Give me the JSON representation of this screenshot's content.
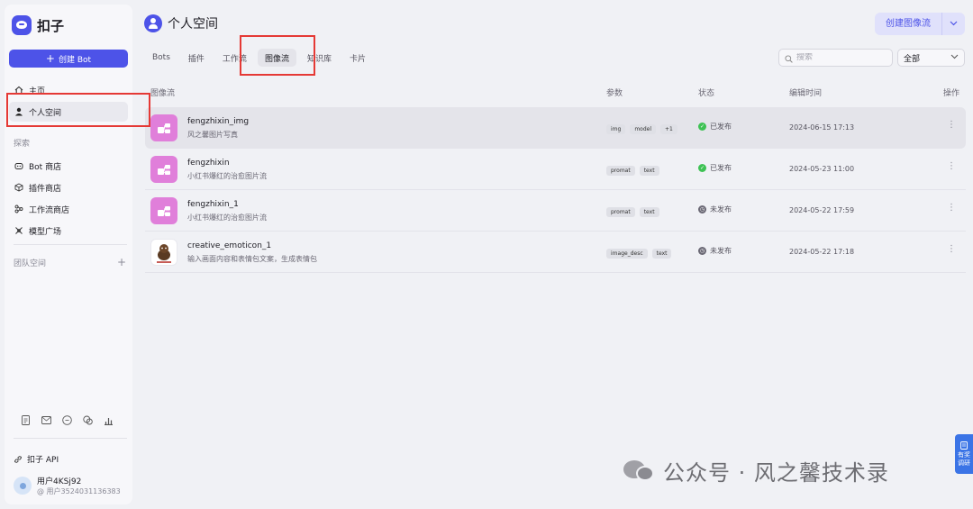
{
  "app": {
    "name": "扣子"
  },
  "sidebar": {
    "create_bot_label": "创建 Bot",
    "nav": [
      {
        "label": "主页",
        "icon": "home-icon"
      },
      {
        "label": "个人空间",
        "icon": "user-icon"
      }
    ],
    "explore_label": "探索",
    "explore": [
      {
        "label": "Bot 商店",
        "icon": "bot-icon"
      },
      {
        "label": "插件商店",
        "icon": "cube-icon"
      },
      {
        "label": "工作流商店",
        "icon": "workflow-icon"
      },
      {
        "label": "模型广场",
        "icon": "model-icon"
      }
    ],
    "team_label": "团队空间",
    "api_label": "扣子 API",
    "user": {
      "name": "用户4KSj92",
      "id": "@ 用户3524031136383"
    }
  },
  "header": {
    "title": "个人空间",
    "create_button": "创建图像流"
  },
  "tabs": [
    {
      "label": "Bots",
      "active": false
    },
    {
      "label": "插件",
      "active": false
    },
    {
      "label": "工作流",
      "active": false
    },
    {
      "label": "图像流",
      "active": true
    },
    {
      "label": "知识库",
      "active": false
    },
    {
      "label": "卡片",
      "active": false
    }
  ],
  "search": {
    "placeholder": "搜索",
    "value": ""
  },
  "filter": {
    "selected": "全部"
  },
  "table": {
    "columns": {
      "name": "图像流",
      "params": "参数",
      "status": "状态",
      "edit_time": "编辑时间",
      "actions": "操作"
    },
    "rows": [
      {
        "name": "fengzhixin_img",
        "desc": "风之馨图片写真",
        "tags": [
          "img",
          "model",
          "+1"
        ],
        "status": "已发布",
        "status_type": "published",
        "time": "2024-06-15 17:13",
        "icon": "image-flow-icon"
      },
      {
        "name": "fengzhixin",
        "desc": "小红书爆红的治愈图片流",
        "tags": [
          "promat",
          "text"
        ],
        "status": "已发布",
        "status_type": "published",
        "time": "2024-05-23 11:00",
        "icon": "image-flow-icon"
      },
      {
        "name": "fengzhixin_1",
        "desc": "小红书爆红的治愈图片流",
        "tags": [
          "promat",
          "text"
        ],
        "status": "未发布",
        "status_type": "unpublished",
        "time": "2024-05-22 17:59",
        "icon": "image-flow-icon"
      },
      {
        "name": "creative_emoticon_1",
        "desc": "输入画面内容和表情包文案，生成表情包",
        "tags": [
          "image_desc",
          "text"
        ],
        "status": "未发布",
        "status_type": "unpublished",
        "time": "2024-05-22 17:18",
        "icon": "emoticon-thumbnail-icon"
      }
    ]
  },
  "watermark": {
    "text": "公众号 · 风之馨技术录"
  },
  "side_tab": {
    "line1": "有奖",
    "line2": "调研"
  },
  "colors": {
    "accent": "#4d53e8",
    "published": "#3ec254",
    "highlight": "#e53935",
    "flow_icon": "#e07fda"
  }
}
